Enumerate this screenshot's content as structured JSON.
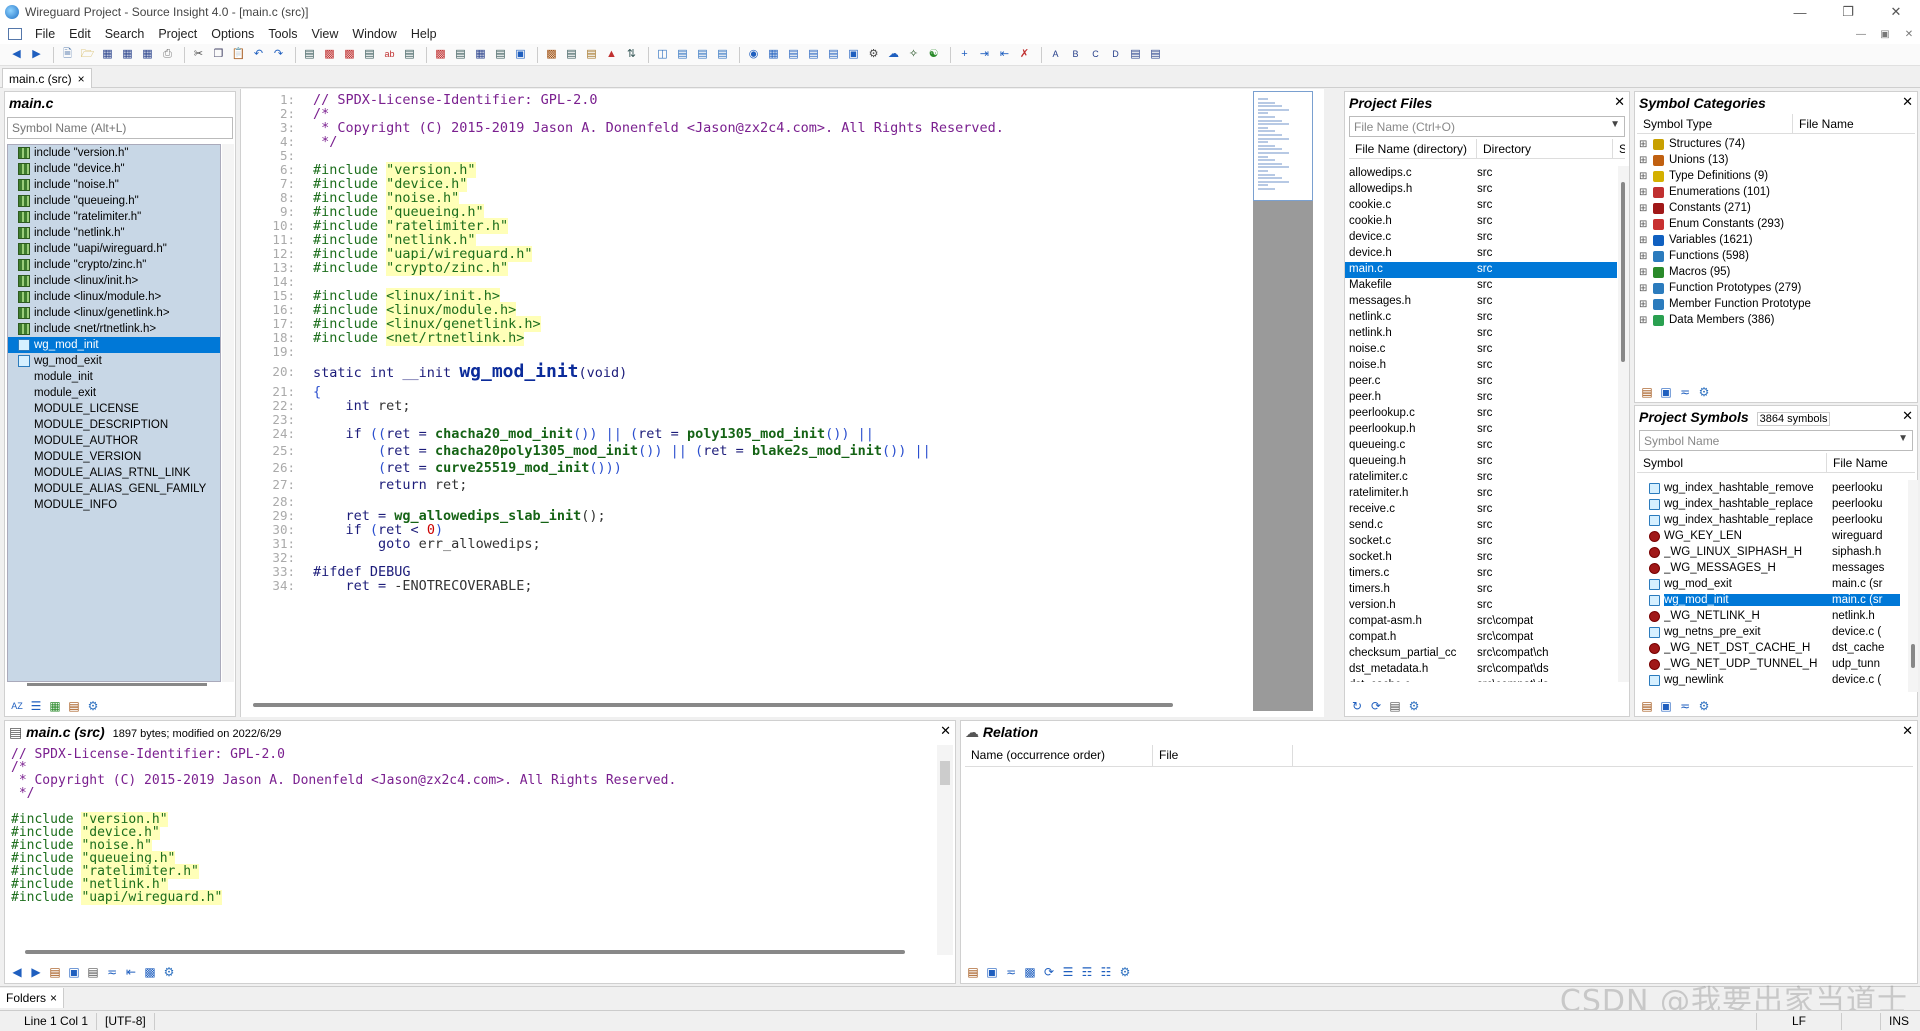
{
  "window": {
    "title": "Wireguard Project - Source Insight 4.0 - [main.c (src)]"
  },
  "menu": [
    "File",
    "Edit",
    "Search",
    "Project",
    "Options",
    "Tools",
    "View",
    "Window",
    "Help"
  ],
  "doc_tab": {
    "label": "main.c (src)",
    "close": "×"
  },
  "symbol_window": {
    "title": "main.c",
    "search_placeholder": "Symbol Name (Alt+L)",
    "items": [
      {
        "label": "include \"version.h\"",
        "icon": "include-icon"
      },
      {
        "label": "include \"device.h\"",
        "icon": "include-icon"
      },
      {
        "label": "include \"noise.h\"",
        "icon": "include-icon"
      },
      {
        "label": "include \"queueing.h\"",
        "icon": "include-icon"
      },
      {
        "label": "include \"ratelimiter.h\"",
        "icon": "include-icon"
      },
      {
        "label": "include \"netlink.h\"",
        "icon": "include-icon"
      },
      {
        "label": "include \"uapi/wireguard.h\"",
        "icon": "include-icon"
      },
      {
        "label": "include \"crypto/zinc.h\"",
        "icon": "include-icon"
      },
      {
        "label": "include <linux/init.h>",
        "icon": "include-icon"
      },
      {
        "label": "include <linux/module.h>",
        "icon": "include-icon"
      },
      {
        "label": "include <linux/genetlink.h>",
        "icon": "include-icon"
      },
      {
        "label": "include <net/rtnetlink.h>",
        "icon": "include-icon"
      },
      {
        "label": "wg_mod_init",
        "icon": "function-icon",
        "selected": true
      },
      {
        "label": "wg_mod_exit",
        "icon": "function-icon"
      },
      {
        "label": "module_init",
        "icon": "blank"
      },
      {
        "label": "module_exit",
        "icon": "blank"
      },
      {
        "label": "MODULE_LICENSE",
        "icon": "blank"
      },
      {
        "label": "MODULE_DESCRIPTION",
        "icon": "blank"
      },
      {
        "label": "MODULE_AUTHOR",
        "icon": "blank"
      },
      {
        "label": "MODULE_VERSION",
        "icon": "blank"
      },
      {
        "label": "MODULE_ALIAS_RTNL_LINK",
        "icon": "blank"
      },
      {
        "label": "MODULE_ALIAS_GENL_FAMILY",
        "icon": "blank"
      },
      {
        "label": "MODULE_INFO",
        "icon": "blank"
      }
    ]
  },
  "editor": {
    "lines": [
      {
        "n": "1:",
        "segs": [
          [
            "com",
            "// SPDX-License-Identifier: GPL-2.0"
          ]
        ]
      },
      {
        "n": "2:",
        "segs": [
          [
            "com",
            "/*"
          ]
        ]
      },
      {
        "n": "3:",
        "segs": [
          [
            "com",
            " * Copyright (C) 2015-2019 Jason A. Donenfeld <Jason@zx2c4.com>. All Rights Reserved."
          ]
        ]
      },
      {
        "n": "4:",
        "segs": [
          [
            "com",
            " */"
          ]
        ]
      },
      {
        "n": "5:",
        "segs": []
      },
      {
        "n": "6:",
        "segs": [
          [
            "pp",
            "#include "
          ],
          [
            "str",
            "\"version.h\""
          ]
        ]
      },
      {
        "n": "7:",
        "segs": [
          [
            "pp",
            "#include "
          ],
          [
            "str",
            "\"device.h\""
          ]
        ]
      },
      {
        "n": "8:",
        "segs": [
          [
            "pp",
            "#include "
          ],
          [
            "str",
            "\"noise.h\""
          ]
        ]
      },
      {
        "n": "9:",
        "segs": [
          [
            "pp",
            "#include "
          ],
          [
            "str",
            "\"queueing.h\""
          ]
        ]
      },
      {
        "n": "10:",
        "segs": [
          [
            "pp",
            "#include "
          ],
          [
            "str",
            "\"ratelimiter.h\""
          ]
        ]
      },
      {
        "n": "11:",
        "segs": [
          [
            "pp",
            "#include "
          ],
          [
            "str",
            "\"netlink.h\""
          ]
        ]
      },
      {
        "n": "12:",
        "segs": [
          [
            "pp",
            "#include "
          ],
          [
            "str",
            "\"uapi/wireguard.h\""
          ]
        ]
      },
      {
        "n": "13:",
        "segs": [
          [
            "pp",
            "#include "
          ],
          [
            "str",
            "\"crypto/zinc.h\""
          ]
        ]
      },
      {
        "n": "14:",
        "segs": []
      },
      {
        "n": "15:",
        "segs": [
          [
            "pp",
            "#include "
          ],
          [
            "str",
            "<linux/init.h>"
          ]
        ]
      },
      {
        "n": "16:",
        "segs": [
          [
            "pp",
            "#include "
          ],
          [
            "str",
            "<linux/module.h>"
          ]
        ]
      },
      {
        "n": "17:",
        "segs": [
          [
            "pp",
            "#include "
          ],
          [
            "str",
            "<linux/genetlink.h>"
          ]
        ]
      },
      {
        "n": "18:",
        "segs": [
          [
            "pp",
            "#include "
          ],
          [
            "str",
            "<net/rtnetlink.h>"
          ]
        ]
      },
      {
        "n": "19:",
        "segs": []
      },
      {
        "n": "20:",
        "segs": [
          [
            "kw",
            "static int __init "
          ],
          [
            "def",
            "wg_mod_init"
          ],
          [
            "kw",
            "(void)"
          ]
        ]
      },
      {
        "n": "21:",
        "segs": [
          [
            "op",
            "{"
          ]
        ]
      },
      {
        "n": "22:",
        "segs": [
          [
            "kw",
            "    int "
          ],
          [
            "id",
            "ret;"
          ]
        ]
      },
      {
        "n": "23:",
        "segs": []
      },
      {
        "n": "24:",
        "segs": [
          [
            "kw",
            "    if "
          ],
          [
            "op",
            "(("
          ],
          [
            "kw",
            "ret = "
          ],
          [
            "fn",
            "chacha20_mod_init"
          ],
          [
            "op",
            "()) || ("
          ],
          [
            "kw",
            "ret = "
          ],
          [
            "fn",
            "poly1305_mod_init"
          ],
          [
            "op",
            "()) ||"
          ]
        ]
      },
      {
        "n": "25:",
        "segs": [
          [
            "op",
            "        ("
          ],
          [
            "kw",
            "ret = "
          ],
          [
            "fn",
            "chacha20poly1305_mod_init"
          ],
          [
            "op",
            "()) || ("
          ],
          [
            "kw",
            "ret = "
          ],
          [
            "fn",
            "blake2s_mod_init"
          ],
          [
            "op",
            "()) ||"
          ]
        ]
      },
      {
        "n": "26:",
        "segs": [
          [
            "op",
            "        ("
          ],
          [
            "kw",
            "ret = "
          ],
          [
            "fn",
            "curve25519_mod_init"
          ],
          [
            "op",
            "()))"
          ]
        ]
      },
      {
        "n": "27:",
        "segs": [
          [
            "kw",
            "        return "
          ],
          [
            "id",
            "ret;"
          ]
        ]
      },
      {
        "n": "28:",
        "segs": []
      },
      {
        "n": "29:",
        "segs": [
          [
            "kw",
            "    ret = "
          ],
          [
            "fn",
            "wg_allowedips_slab_init"
          ],
          [
            "id",
            "();"
          ]
        ]
      },
      {
        "n": "30:",
        "segs": [
          [
            "kw",
            "    if "
          ],
          [
            "op",
            "("
          ],
          [
            "kw",
            "ret < "
          ],
          [
            "num",
            "0"
          ],
          [
            "op",
            ")"
          ]
        ]
      },
      {
        "n": "31:",
        "segs": [
          [
            "kw",
            "        goto "
          ],
          [
            "id",
            "err_allowedips;"
          ]
        ]
      },
      {
        "n": "32:",
        "segs": []
      },
      {
        "n": "33:",
        "segs": [
          [
            "kw",
            "#ifdef DEBUG"
          ]
        ]
      },
      {
        "n": "34:",
        "segs": [
          [
            "kw",
            "    ret = "
          ],
          [
            "id",
            "-ENOTRECOVERABLE;"
          ]
        ]
      }
    ]
  },
  "project_files": {
    "title": "Project Files",
    "search_placeholder": "File Name (Ctrl+O)",
    "columns": [
      "File Name (directory)",
      "Directory",
      "S"
    ],
    "rows": [
      [
        "allowedips.c",
        "src"
      ],
      [
        "allowedips.h",
        "src"
      ],
      [
        "cookie.c",
        "src"
      ],
      [
        "cookie.h",
        "src"
      ],
      [
        "device.c",
        "src"
      ],
      [
        "device.h",
        "src"
      ],
      [
        "main.c",
        "src"
      ],
      [
        "Makefile",
        "src"
      ],
      [
        "messages.h",
        "src"
      ],
      [
        "netlink.c",
        "src"
      ],
      [
        "netlink.h",
        "src"
      ],
      [
        "noise.c",
        "src"
      ],
      [
        "noise.h",
        "src"
      ],
      [
        "peer.c",
        "src"
      ],
      [
        "peer.h",
        "src"
      ],
      [
        "peerlookup.c",
        "src"
      ],
      [
        "peerlookup.h",
        "src"
      ],
      [
        "queueing.c",
        "src"
      ],
      [
        "queueing.h",
        "src"
      ],
      [
        "ratelimiter.c",
        "src"
      ],
      [
        "ratelimiter.h",
        "src"
      ],
      [
        "receive.c",
        "src"
      ],
      [
        "send.c",
        "src"
      ],
      [
        "socket.c",
        "src"
      ],
      [
        "socket.h",
        "src"
      ],
      [
        "timers.c",
        "src"
      ],
      [
        "timers.h",
        "src"
      ],
      [
        "version.h",
        "src"
      ],
      [
        "compat-asm.h",
        "src\\compat"
      ],
      [
        "compat.h",
        "src\\compat"
      ],
      [
        "checksum_partial_cc",
        "src\\compat\\ch"
      ],
      [
        "dst_metadata.h",
        "src\\compat\\ds"
      ],
      [
        "dst_cache.c",
        "src\\compat\\ds"
      ]
    ],
    "selected_index": 6
  },
  "symbol_categories": {
    "title": "Symbol Categories",
    "columns": [
      "Symbol Type",
      "File Name"
    ],
    "rows": [
      {
        "label": "Structures (74)",
        "color": "#c8a000"
      },
      {
        "label": "Unions (13)",
        "color": "#c06010"
      },
      {
        "label": "Type Definitions (9)",
        "color": "#d4b000"
      },
      {
        "label": "Enumerations (101)",
        "color": "#c03030"
      },
      {
        "label": "Constants (271)",
        "color": "#a01818"
      },
      {
        "label": "Enum Constants (293)",
        "color": "#c83030"
      },
      {
        "label": "Variables (1621)",
        "color": "#1060c0"
      },
      {
        "label": "Functions (598)",
        "color": "#2b7bbd"
      },
      {
        "label": "Macros (95)",
        "color": "#2a8a2a"
      },
      {
        "label": "Function Prototypes (279)",
        "color": "#2b7bbd"
      },
      {
        "label": "Member Function Prototype",
        "color": "#2b7bbd"
      },
      {
        "label": "Data Members (386)",
        "color": "#2aa050"
      }
    ]
  },
  "project_symbols": {
    "title": "Project Symbols",
    "count": "3864 symbols",
    "search_placeholder": "Symbol Name",
    "columns": [
      "Symbol",
      "File Name"
    ],
    "rows": [
      {
        "name": "wg_index_hashtable_remove",
        "file": "peerlooku",
        "icon": "func"
      },
      {
        "name": "wg_index_hashtable_replace",
        "file": "peerlooku",
        "icon": "func"
      },
      {
        "name": "wg_index_hashtable_replace",
        "file": "peerlooku",
        "icon": "func"
      },
      {
        "name": "WG_KEY_LEN",
        "file": "wireguard",
        "icon": "const"
      },
      {
        "name": "_WG_LINUX_SIPHASH_H",
        "file": "siphash.h",
        "icon": "const"
      },
      {
        "name": "_WG_MESSAGES_H",
        "file": "messages",
        "icon": "const"
      },
      {
        "name": "wg_mod_exit",
        "file": "main.c (sr",
        "icon": "func"
      },
      {
        "name": "wg_mod_init",
        "file": "main.c (sr",
        "icon": "func",
        "selected": true
      },
      {
        "name": "_WG_NETLINK_H",
        "file": "netlink.h",
        "icon": "const"
      },
      {
        "name": "wg_netns_pre_exit",
        "file": "device.c (",
        "icon": "func"
      },
      {
        "name": "_WG_NET_DST_CACHE_H",
        "file": "dst_cache",
        "icon": "const"
      },
      {
        "name": "_WG_NET_UDP_TUNNEL_H",
        "file": "udp_tunn",
        "icon": "const"
      },
      {
        "name": "wg_newlink",
        "file": "device.c (",
        "icon": "func"
      }
    ]
  },
  "context": {
    "title": "main.c (src)",
    "meta": "1897 bytes; modified on 2022/6/29",
    "lines": [
      [
        [
          "com",
          "// SPDX-License-Identifier: GPL-2.0"
        ]
      ],
      [
        [
          "com",
          "/*"
        ]
      ],
      [
        [
          "com",
          " * Copyright (C) 2015-2019 Jason A. Donenfeld <Jason@zx2c4.com>. All Rights Reserved."
        ]
      ],
      [
        [
          "com",
          " */"
        ]
      ],
      [],
      [
        [
          "pp",
          "#include "
        ],
        [
          "str",
          "\"version.h\""
        ]
      ],
      [
        [
          "pp",
          "#include "
        ],
        [
          "str",
          "\"device.h\""
        ]
      ],
      [
        [
          "pp",
          "#include "
        ],
        [
          "str",
          "\"noise.h\""
        ]
      ],
      [
        [
          "pp",
          "#include "
        ],
        [
          "str",
          "\"queueing.h\""
        ]
      ],
      [
        [
          "pp",
          "#include "
        ],
        [
          "str",
          "\"ratelimiter.h\""
        ]
      ],
      [
        [
          "pp",
          "#include "
        ],
        [
          "str",
          "\"netlink.h\""
        ]
      ],
      [
        [
          "pp",
          "#include "
        ],
        [
          "str",
          "\"uapi/wireguard.h\""
        ]
      ]
    ]
  },
  "relation": {
    "title": "Relation",
    "columns": [
      "Name (occurrence order)",
      "File"
    ]
  },
  "folders_tab": {
    "label": "Folders",
    "close": "×"
  },
  "status": {
    "position": "Line 1  Col 1",
    "encoding": "[UTF-8]",
    "line_ending": "LF",
    "mode": "INS"
  },
  "watermark": "CSDN @我要出家当道士",
  "colors": {
    "selection": "#0078d7",
    "symbol_list_bg": "#c8d7e6",
    "string_highlight": "#ffffb8"
  }
}
